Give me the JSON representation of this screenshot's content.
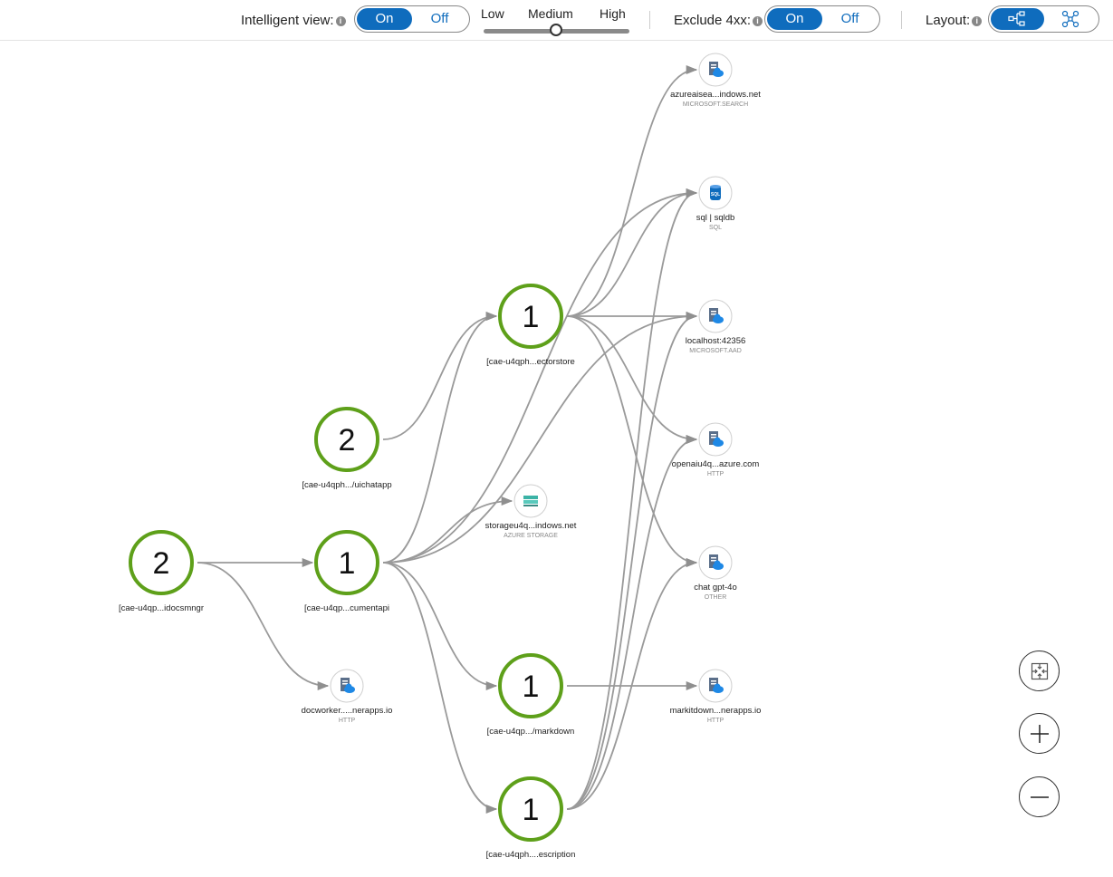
{
  "toolbar": {
    "intelligent_view": {
      "label": "Intelligent view:",
      "on": "On",
      "off": "Off",
      "selected": "On"
    },
    "slider": {
      "low": "Low",
      "medium": "Medium",
      "high": "High",
      "value": "Medium"
    },
    "exclude_4xx": {
      "label": "Exclude 4xx:",
      "on": "On",
      "off": "Off",
      "selected": "On"
    },
    "layout": {
      "label": "Layout:",
      "options": [
        "hierarchical-layout-icon",
        "network-layout-icon"
      ],
      "selected": "hierarchical-layout-icon"
    },
    "info_icon": "i"
  },
  "colors": {
    "accent": "#0f6cbd",
    "node_ring": "#5ea01a",
    "edge": "#9a9a9a"
  },
  "graph": {
    "nodes": [
      {
        "id": "docsmngr",
        "kind": "app",
        "count": "2",
        "label": "[cae-u4qp...idocsmngr"
      },
      {
        "id": "uichatapp",
        "kind": "app",
        "count": "2",
        "label": "[cae-u4qph.../uichatapp"
      },
      {
        "id": "documentapi",
        "kind": "app",
        "count": "1",
        "label": "[cae-u4qp...cumentapi"
      },
      {
        "id": "vectorstore",
        "kind": "app",
        "count": "1",
        "label": "[cae-u4qph...ectorstore"
      },
      {
        "id": "markdown",
        "kind": "app",
        "count": "1",
        "label": "[cae-u4qp.../markdown"
      },
      {
        "id": "description",
        "kind": "app",
        "count": "1",
        "label": "[cae-u4qph....escription"
      },
      {
        "id": "docworker",
        "kind": "dep",
        "icon": "server-cloud-icon",
        "label": "docworker.....nerapps.io",
        "type": "HTTP"
      },
      {
        "id": "storage",
        "kind": "dep",
        "icon": "storage-icon",
        "label": "storageu4q...indows.net",
        "type": "AZURE STORAGE"
      },
      {
        "id": "search",
        "kind": "dep",
        "icon": "server-cloud-icon",
        "label": "azureaisea...indows.net",
        "type": "MICROSOFT.SEARCH"
      },
      {
        "id": "sql",
        "kind": "dep",
        "icon": "sql-icon",
        "label": "sql | sqldb",
        "type": "SQL"
      },
      {
        "id": "localhost",
        "kind": "dep",
        "icon": "server-cloud-icon",
        "label": "localhost:42356",
        "type": "MICROSOFT.AAD"
      },
      {
        "id": "openai",
        "kind": "dep",
        "icon": "server-cloud-icon",
        "label": "openaiu4q...azure.com",
        "type": "HTTP"
      },
      {
        "id": "chatgpt",
        "kind": "dep",
        "icon": "server-cloud-icon",
        "label": "chat gpt-4o",
        "type": "OTHER"
      },
      {
        "id": "markitdown",
        "kind": "dep",
        "icon": "server-cloud-icon",
        "label": "markitdown...nerapps.io",
        "type": "HTTP"
      }
    ],
    "edges": [
      [
        "docsmngr",
        "documentapi"
      ],
      [
        "docsmngr",
        "docworker"
      ],
      [
        "uichatapp",
        "vectorstore"
      ],
      [
        "documentapi",
        "vectorstore"
      ],
      [
        "documentapi",
        "storage"
      ],
      [
        "documentapi",
        "sql"
      ],
      [
        "documentapi",
        "localhost"
      ],
      [
        "documentapi",
        "markdown"
      ],
      [
        "documentapi",
        "description"
      ],
      [
        "vectorstore",
        "search"
      ],
      [
        "vectorstore",
        "sql"
      ],
      [
        "vectorstore",
        "localhost"
      ],
      [
        "vectorstore",
        "openai"
      ],
      [
        "vectorstore",
        "chatgpt"
      ],
      [
        "markdown",
        "markitdown"
      ],
      [
        "description",
        "sql"
      ],
      [
        "description",
        "localhost"
      ],
      [
        "description",
        "openai"
      ],
      [
        "description",
        "chatgpt"
      ]
    ]
  },
  "zoom_controls": [
    "fit-to-screen-icon",
    "zoom-in-icon",
    "zoom-out-icon"
  ]
}
